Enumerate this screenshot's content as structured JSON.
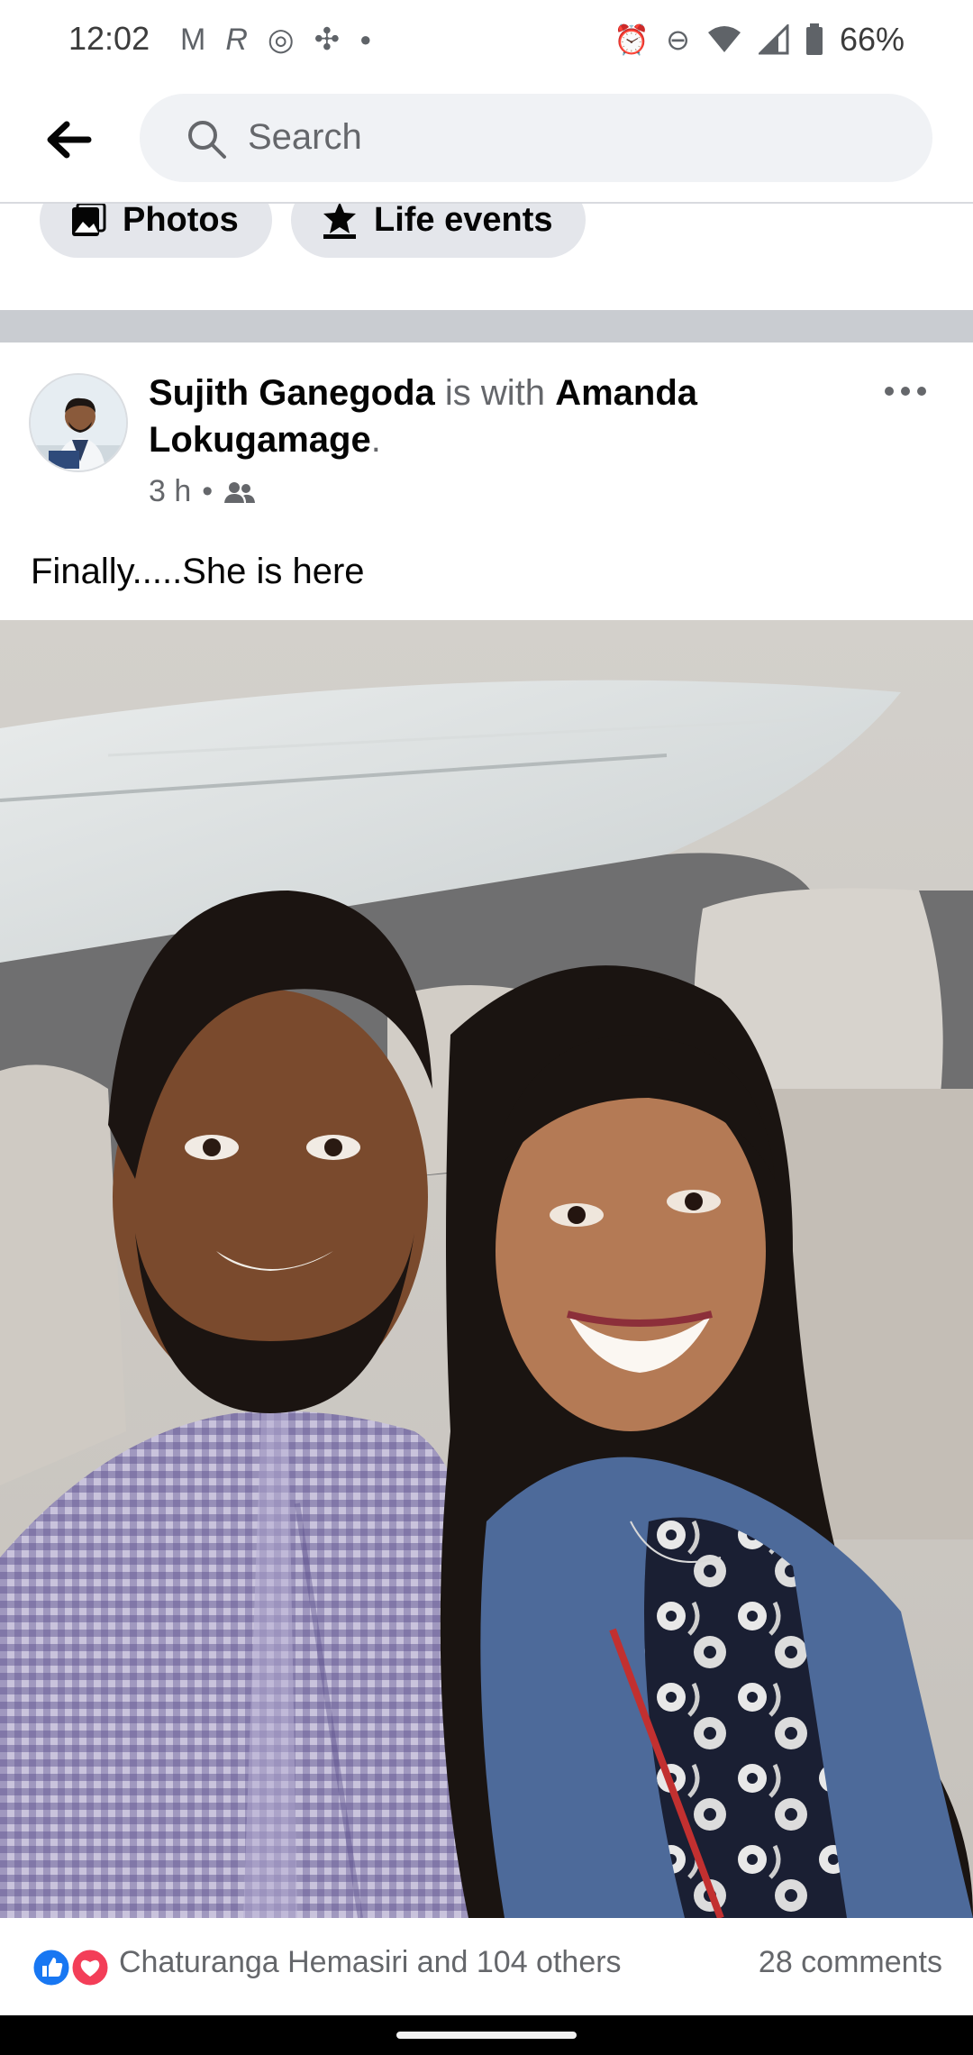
{
  "status_bar": {
    "time": "12:02",
    "left_icons": [
      "gmail-icon",
      "r-icon",
      "chrome-icon",
      "apps-icon",
      "dot-icon"
    ],
    "right_icons": [
      "alarm-icon",
      "dnd-icon",
      "wifi-icon",
      "signal-icon",
      "battery-icon"
    ],
    "battery": "66%"
  },
  "header": {
    "search_placeholder": "Search"
  },
  "chips": [
    {
      "label": "Photos",
      "icon": "photos-icon"
    },
    {
      "label": "Life events",
      "icon": "star-flag-icon"
    }
  ],
  "post": {
    "author": "Sujith Ganegoda",
    "with_text": "is with",
    "tagged": "Amanda Lokugamage",
    "period": ".",
    "time": "3 h",
    "separator": "•",
    "audience_icon": "friends-icon",
    "text": "Finally.....She is here",
    "reactions_text": "Chaturanga Hemasiri and 104 others",
    "comments_text": "28 comments",
    "reaction_icons": [
      "like-icon",
      "love-icon"
    ]
  },
  "colors": {
    "fb_blue": "#1877f2",
    "love_red": "#f33e58",
    "search_bg": "#f0f2f5",
    "chip_bg": "#e4e6eb",
    "muted_text": "#65676b"
  }
}
